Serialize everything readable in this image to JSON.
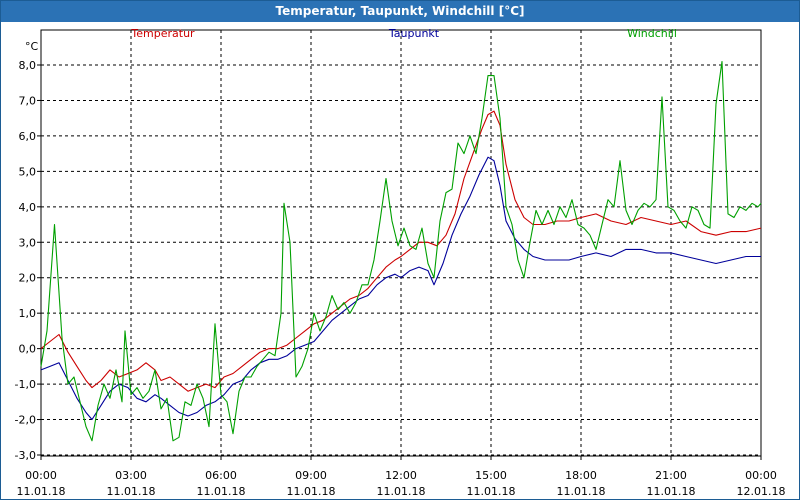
{
  "window": {
    "title": "Temperatur, Taupunkt, Windchill [°C]"
  },
  "chart_data": {
    "type": "line",
    "title": "Temperatur, Taupunkt, Windchill [°C]",
    "ylabel": "°C",
    "ylim": [
      -3.0,
      8.0
    ],
    "xlim": [
      0,
      24
    ],
    "grid": true,
    "legend_position": "top",
    "y_ticks": [
      "-3,0",
      "-2,0",
      "-1,0",
      "0,0",
      "1,0",
      "2,0",
      "3,0",
      "4,0",
      "5,0",
      "6,0",
      "7,0",
      "8,0"
    ],
    "y_tick_values": [
      -3,
      -2,
      -1,
      0,
      1,
      2,
      3,
      4,
      5,
      6,
      7,
      8
    ],
    "x_ticks": [
      {
        "time": "00:00",
        "date": "11.01.18",
        "h": 0
      },
      {
        "time": "03:00",
        "date": "11.01.18",
        "h": 3
      },
      {
        "time": "06:00",
        "date": "11.01.18",
        "h": 6
      },
      {
        "time": "09:00",
        "date": "11.01.18",
        "h": 9
      },
      {
        "time": "12:00",
        "date": "11.01.18",
        "h": 12
      },
      {
        "time": "15:00",
        "date": "11.01.18",
        "h": 15
      },
      {
        "time": "18:00",
        "date": "11.01.18",
        "h": 18
      },
      {
        "time": "21:00",
        "date": "11.01.18",
        "h": 21
      },
      {
        "time": "00:00",
        "date": "12.01.18",
        "h": 24
      }
    ],
    "series": [
      {
        "name": "Temperatur",
        "color": "#cc0000",
        "points": [
          [
            0,
            0.0
          ],
          [
            0.3,
            0.2
          ],
          [
            0.6,
            0.4
          ],
          [
            0.9,
            -0.1
          ],
          [
            1.2,
            -0.5
          ],
          [
            1.5,
            -0.9
          ],
          [
            1.7,
            -1.1
          ],
          [
            2.0,
            -0.9
          ],
          [
            2.3,
            -0.6
          ],
          [
            2.6,
            -0.8
          ],
          [
            2.9,
            -0.7
          ],
          [
            3.2,
            -0.6
          ],
          [
            3.5,
            -0.4
          ],
          [
            3.8,
            -0.6
          ],
          [
            4.0,
            -0.9
          ],
          [
            4.3,
            -0.8
          ],
          [
            4.6,
            -1.0
          ],
          [
            4.9,
            -1.2
          ],
          [
            5.2,
            -1.1
          ],
          [
            5.5,
            -1.0
          ],
          [
            5.8,
            -1.1
          ],
          [
            6.1,
            -0.8
          ],
          [
            6.4,
            -0.7
          ],
          [
            6.7,
            -0.5
          ],
          [
            7.0,
            -0.3
          ],
          [
            7.3,
            -0.1
          ],
          [
            7.6,
            0.0
          ],
          [
            7.9,
            0.0
          ],
          [
            8.2,
            0.1
          ],
          [
            8.5,
            0.3
          ],
          [
            8.8,
            0.5
          ],
          [
            9.1,
            0.7
          ],
          [
            9.4,
            0.8
          ],
          [
            9.7,
            1.0
          ],
          [
            10.0,
            1.2
          ],
          [
            10.3,
            1.4
          ],
          [
            10.6,
            1.5
          ],
          [
            10.9,
            1.7
          ],
          [
            11.2,
            2.0
          ],
          [
            11.5,
            2.3
          ],
          [
            11.8,
            2.5
          ],
          [
            12.0,
            2.6
          ],
          [
            12.3,
            2.8
          ],
          [
            12.6,
            3.0
          ],
          [
            12.9,
            3.0
          ],
          [
            13.2,
            2.9
          ],
          [
            13.5,
            3.2
          ],
          [
            13.8,
            3.8
          ],
          [
            14.1,
            4.8
          ],
          [
            14.4,
            5.5
          ],
          [
            14.7,
            6.2
          ],
          [
            14.9,
            6.6
          ],
          [
            15.1,
            6.7
          ],
          [
            15.3,
            6.3
          ],
          [
            15.5,
            5.2
          ],
          [
            15.8,
            4.2
          ],
          [
            16.1,
            3.7
          ],
          [
            16.4,
            3.5
          ],
          [
            16.8,
            3.5
          ],
          [
            17.2,
            3.6
          ],
          [
            17.6,
            3.6
          ],
          [
            18.0,
            3.7
          ],
          [
            18.5,
            3.8
          ],
          [
            19.0,
            3.6
          ],
          [
            19.5,
            3.5
          ],
          [
            20.0,
            3.7
          ],
          [
            20.5,
            3.6
          ],
          [
            21.0,
            3.5
          ],
          [
            21.5,
            3.6
          ],
          [
            22.0,
            3.3
          ],
          [
            22.5,
            3.2
          ],
          [
            23.0,
            3.3
          ],
          [
            23.5,
            3.3
          ],
          [
            24.0,
            3.4
          ]
        ]
      },
      {
        "name": "Taupunkt",
        "color": "#00009a",
        "points": [
          [
            0,
            -0.6
          ],
          [
            0.3,
            -0.5
          ],
          [
            0.6,
            -0.4
          ],
          [
            0.9,
            -0.9
          ],
          [
            1.2,
            -1.4
          ],
          [
            1.5,
            -1.8
          ],
          [
            1.7,
            -2.0
          ],
          [
            2.0,
            -1.6
          ],
          [
            2.3,
            -1.2
          ],
          [
            2.6,
            -1.0
          ],
          [
            2.9,
            -1.1
          ],
          [
            3.2,
            -1.4
          ],
          [
            3.5,
            -1.5
          ],
          [
            3.8,
            -1.3
          ],
          [
            4.0,
            -1.4
          ],
          [
            4.3,
            -1.6
          ],
          [
            4.6,
            -1.8
          ],
          [
            4.9,
            -1.9
          ],
          [
            5.2,
            -1.8
          ],
          [
            5.5,
            -1.6
          ],
          [
            5.8,
            -1.5
          ],
          [
            6.1,
            -1.3
          ],
          [
            6.4,
            -1.0
          ],
          [
            6.7,
            -0.9
          ],
          [
            7.0,
            -0.6
          ],
          [
            7.3,
            -0.4
          ],
          [
            7.6,
            -0.3
          ],
          [
            7.9,
            -0.3
          ],
          [
            8.2,
            -0.2
          ],
          [
            8.5,
            0.0
          ],
          [
            8.8,
            0.1
          ],
          [
            9.1,
            0.2
          ],
          [
            9.4,
            0.5
          ],
          [
            9.7,
            0.8
          ],
          [
            10.0,
            1.0
          ],
          [
            10.3,
            1.2
          ],
          [
            10.6,
            1.4
          ],
          [
            10.9,
            1.5
          ],
          [
            11.2,
            1.8
          ],
          [
            11.5,
            2.0
          ],
          [
            11.8,
            2.1
          ],
          [
            12.0,
            2.0
          ],
          [
            12.3,
            2.2
          ],
          [
            12.6,
            2.3
          ],
          [
            12.9,
            2.2
          ],
          [
            13.1,
            1.8
          ],
          [
            13.4,
            2.4
          ],
          [
            13.7,
            3.2
          ],
          [
            14.0,
            3.8
          ],
          [
            14.3,
            4.3
          ],
          [
            14.6,
            4.9
          ],
          [
            14.9,
            5.4
          ],
          [
            15.1,
            5.3
          ],
          [
            15.3,
            4.6
          ],
          [
            15.5,
            3.6
          ],
          [
            15.8,
            3.1
          ],
          [
            16.1,
            2.8
          ],
          [
            16.4,
            2.6
          ],
          [
            16.8,
            2.5
          ],
          [
            17.2,
            2.5
          ],
          [
            17.6,
            2.5
          ],
          [
            18.0,
            2.6
          ],
          [
            18.5,
            2.7
          ],
          [
            19.0,
            2.6
          ],
          [
            19.5,
            2.8
          ],
          [
            20.0,
            2.8
          ],
          [
            20.5,
            2.7
          ],
          [
            21.0,
            2.7
          ],
          [
            21.5,
            2.6
          ],
          [
            22.0,
            2.5
          ],
          [
            22.5,
            2.4
          ],
          [
            23.0,
            2.5
          ],
          [
            23.5,
            2.6
          ],
          [
            24.0,
            2.6
          ]
        ]
      },
      {
        "name": "Windchill",
        "color": "#00a000",
        "points": [
          [
            0,
            -0.5
          ],
          [
            0.2,
            0.5
          ],
          [
            0.45,
            3.5
          ],
          [
            0.7,
            0.3
          ],
          [
            0.9,
            -1.0
          ],
          [
            1.1,
            -0.8
          ],
          [
            1.3,
            -1.5
          ],
          [
            1.5,
            -2.2
          ],
          [
            1.7,
            -2.6
          ],
          [
            1.9,
            -1.6
          ],
          [
            2.1,
            -1.0
          ],
          [
            2.3,
            -1.4
          ],
          [
            2.5,
            -0.6
          ],
          [
            2.7,
            -1.5
          ],
          [
            2.8,
            0.5
          ],
          [
            3.0,
            -1.3
          ],
          [
            3.2,
            -1.1
          ],
          [
            3.4,
            -1.4
          ],
          [
            3.6,
            -1.2
          ],
          [
            3.8,
            -0.6
          ],
          [
            4.0,
            -1.7
          ],
          [
            4.2,
            -1.4
          ],
          [
            4.4,
            -2.6
          ],
          [
            4.6,
            -2.5
          ],
          [
            4.8,
            -1.5
          ],
          [
            5.0,
            -1.6
          ],
          [
            5.2,
            -1.0
          ],
          [
            5.4,
            -1.4
          ],
          [
            5.6,
            -2.2
          ],
          [
            5.8,
            0.7
          ],
          [
            6.0,
            -1.3
          ],
          [
            6.2,
            -1.5
          ],
          [
            6.4,
            -2.4
          ],
          [
            6.6,
            -1.2
          ],
          [
            6.8,
            -0.8
          ],
          [
            7.0,
            -0.8
          ],
          [
            7.2,
            -0.5
          ],
          [
            7.4,
            -0.3
          ],
          [
            7.6,
            -0.1
          ],
          [
            7.8,
            -0.2
          ],
          [
            8.0,
            1.0
          ],
          [
            8.1,
            4.1
          ],
          [
            8.3,
            3.0
          ],
          [
            8.5,
            -0.8
          ],
          [
            8.7,
            -0.5
          ],
          [
            8.9,
            0.0
          ],
          [
            9.1,
            1.0
          ],
          [
            9.3,
            0.5
          ],
          [
            9.5,
            0.9
          ],
          [
            9.7,
            1.5
          ],
          [
            9.9,
            1.1
          ],
          [
            10.1,
            1.3
          ],
          [
            10.3,
            1.0
          ],
          [
            10.5,
            1.3
          ],
          [
            10.7,
            1.8
          ],
          [
            10.9,
            1.8
          ],
          [
            11.1,
            2.5
          ],
          [
            11.3,
            3.6
          ],
          [
            11.5,
            4.8
          ],
          [
            11.7,
            3.6
          ],
          [
            11.9,
            2.9
          ],
          [
            12.1,
            3.4
          ],
          [
            12.3,
            2.9
          ],
          [
            12.5,
            2.8
          ],
          [
            12.7,
            3.4
          ],
          [
            12.9,
            2.4
          ],
          [
            13.1,
            2.0
          ],
          [
            13.3,
            3.6
          ],
          [
            13.5,
            4.4
          ],
          [
            13.7,
            4.5
          ],
          [
            13.9,
            5.8
          ],
          [
            14.1,
            5.5
          ],
          [
            14.3,
            6.0
          ],
          [
            14.5,
            5.5
          ],
          [
            14.7,
            6.5
          ],
          [
            14.9,
            7.7
          ],
          [
            15.1,
            7.7
          ],
          [
            15.3,
            6.5
          ],
          [
            15.5,
            4.0
          ],
          [
            15.7,
            3.5
          ],
          [
            15.9,
            2.5
          ],
          [
            16.1,
            2.0
          ],
          [
            16.3,
            3.0
          ],
          [
            16.5,
            3.9
          ],
          [
            16.7,
            3.5
          ],
          [
            16.9,
            3.9
          ],
          [
            17.1,
            3.5
          ],
          [
            17.3,
            4.0
          ],
          [
            17.5,
            3.7
          ],
          [
            17.7,
            4.2
          ],
          [
            17.9,
            3.5
          ],
          [
            18.1,
            3.4
          ],
          [
            18.3,
            3.2
          ],
          [
            18.5,
            2.8
          ],
          [
            18.7,
            3.5
          ],
          [
            18.9,
            4.2
          ],
          [
            19.1,
            4.0
          ],
          [
            19.3,
            5.3
          ],
          [
            19.5,
            3.9
          ],
          [
            19.7,
            3.5
          ],
          [
            19.9,
            3.9
          ],
          [
            20.1,
            4.1
          ],
          [
            20.3,
            4.0
          ],
          [
            20.5,
            4.2
          ],
          [
            20.7,
            7.1
          ],
          [
            20.9,
            4.0
          ],
          [
            21.1,
            3.9
          ],
          [
            21.3,
            3.6
          ],
          [
            21.5,
            3.4
          ],
          [
            21.7,
            4.0
          ],
          [
            21.9,
            3.9
          ],
          [
            22.1,
            3.5
          ],
          [
            22.3,
            3.4
          ],
          [
            22.5,
            6.9
          ],
          [
            22.7,
            8.1
          ],
          [
            22.9,
            3.8
          ],
          [
            23.1,
            3.7
          ],
          [
            23.3,
            4.0
          ],
          [
            23.5,
            3.9
          ],
          [
            23.7,
            4.1
          ],
          [
            23.9,
            4.0
          ],
          [
            24.0,
            4.1
          ]
        ]
      }
    ]
  }
}
